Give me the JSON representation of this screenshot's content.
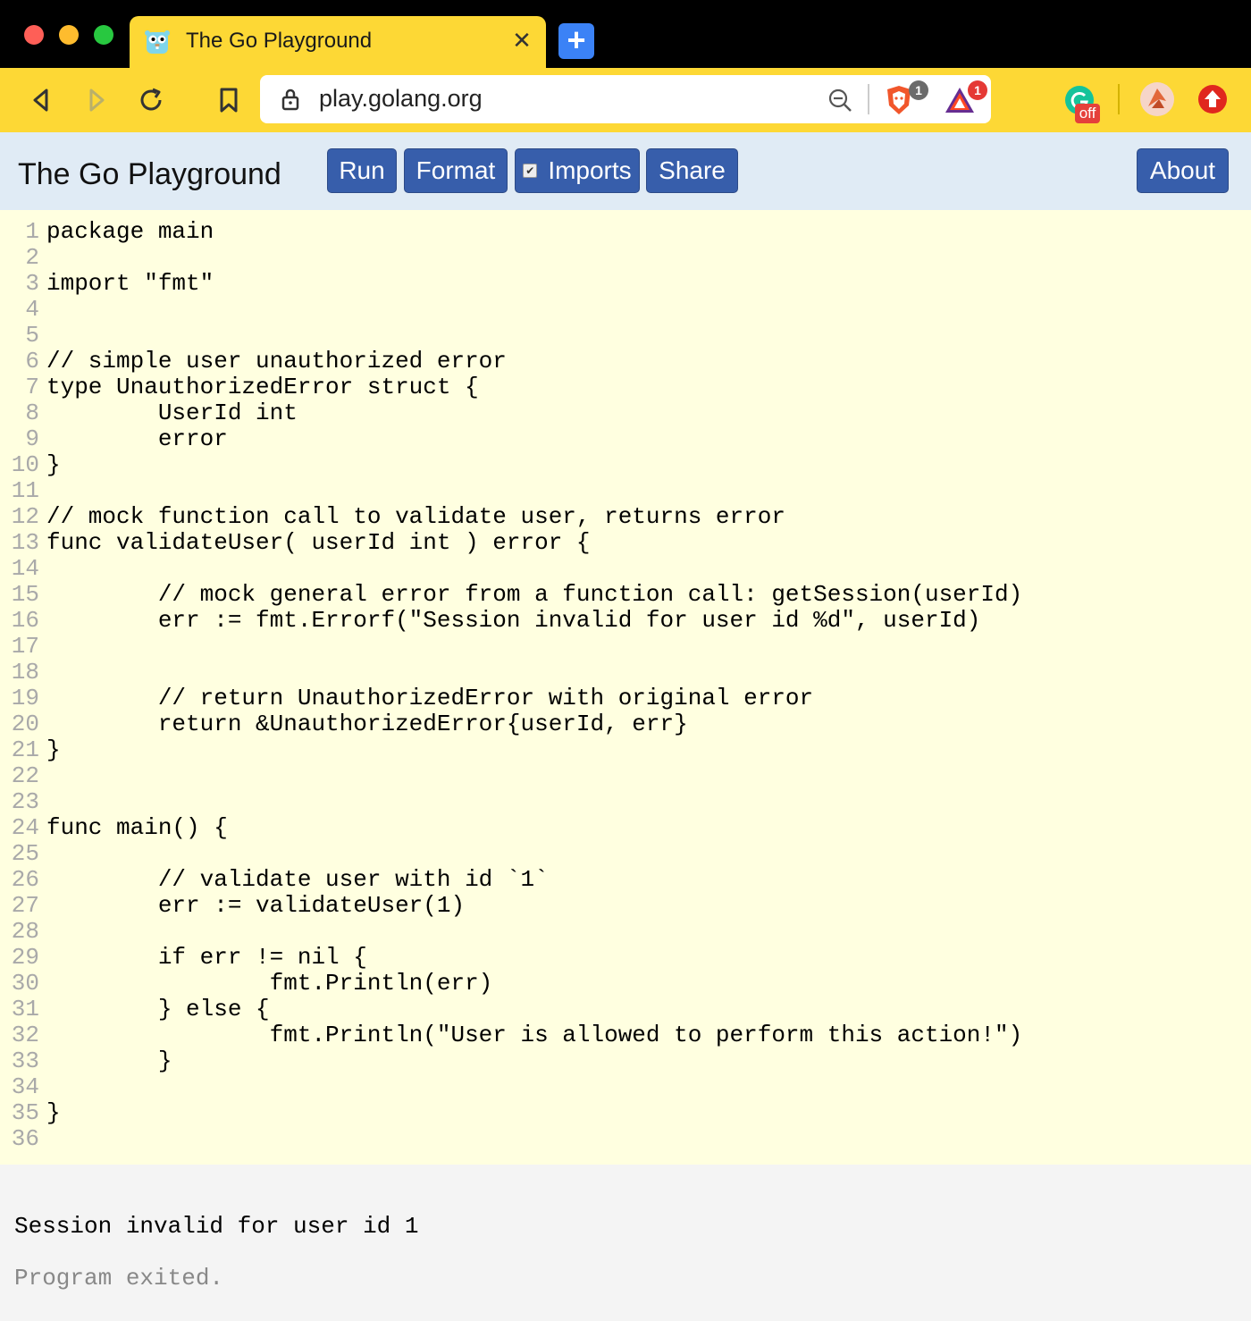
{
  "browser": {
    "tab": {
      "title": "The Go Playground",
      "close_glyph": "✕",
      "favicon": "gopher-icon"
    },
    "new_tab_glyph": "+",
    "url": "play.golang.org",
    "extensions": {
      "brave_badge": "1",
      "bat_badge": "1",
      "grammarly_label": "off"
    }
  },
  "playground": {
    "title": "The Go Playground",
    "buttons": {
      "run": "Run",
      "format": "Format",
      "imports": "Imports",
      "share": "Share",
      "about": "About"
    },
    "imports_checked": "✔"
  },
  "code_lines": [
    "package main",
    "",
    "import \"fmt\"",
    "",
    "",
    "// simple user unauthorized error",
    "type UnauthorizedError struct {",
    "        UserId int",
    "        error",
    "}",
    "",
    "// mock function call to validate user, returns error",
    "func validateUser( userId int ) error {",
    "",
    "        // mock general error from a function call: getSession(userId)",
    "        err := fmt.Errorf(\"Session invalid for user id %d\", userId)",
    "",
    "",
    "        // return UnauthorizedError with original error",
    "        return &UnauthorizedError{userId, err}",
    "}",
    "",
    "",
    "func main() {",
    "",
    "        // validate user with id `1`",
    "        err := validateUser(1)",
    "",
    "        if err != nil {",
    "                fmt.Println(err)",
    "        } else {",
    "                fmt.Println(\"User is allowed to perform this action!\")",
    "        }",
    "",
    "}",
    ""
  ],
  "output": {
    "text": "Session invalid for user id 1",
    "exit": "Program exited."
  },
  "colors": {
    "tab_yellow": "#fdd835",
    "header_bg": "#e0ebf5",
    "button_blue": "#375eab",
    "editor_bg": "#ffffe0",
    "output_bg": "#f4f4f4"
  }
}
